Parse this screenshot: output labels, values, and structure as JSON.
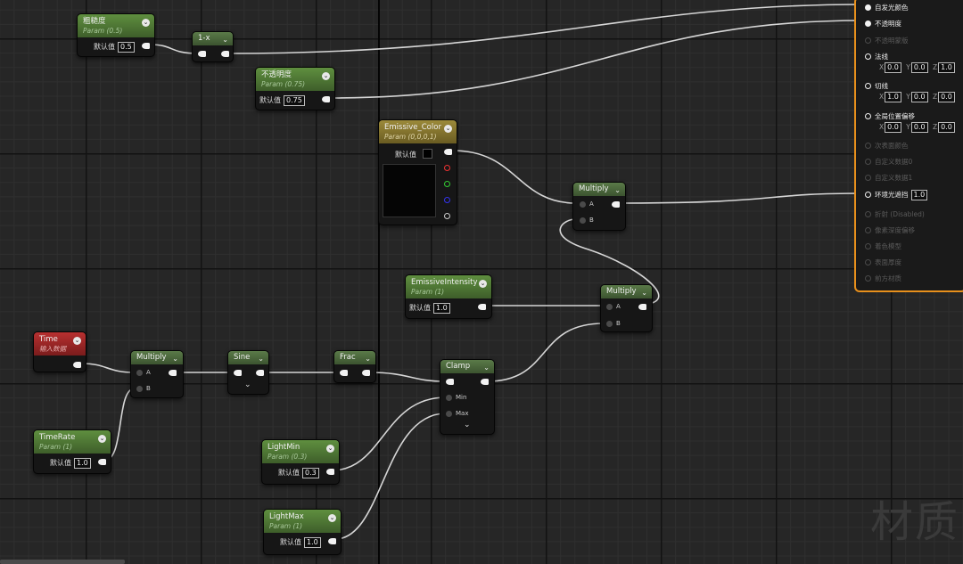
{
  "nodes": {
    "roughness": {
      "title": "粗糙度",
      "subtitle": "Param (0.5)",
      "label": "默认值",
      "value": "0.5"
    },
    "one_minus": {
      "title": "1-x"
    },
    "opacity": {
      "title": "不透明度",
      "subtitle": "Param (0.75)",
      "label": "默认值",
      "value": "0.75"
    },
    "emissive_color": {
      "title": "Emissive_Color",
      "subtitle": "Param (0,0,0,1)",
      "label": "默认值"
    },
    "multiply_top": {
      "title": "Multiply",
      "pin_a": "A",
      "pin_b": "B"
    },
    "emissive_intensity": {
      "title": "EmissiveIntensity",
      "subtitle": "Param (1)",
      "label": "默认值",
      "value": "1.0"
    },
    "multiply_mid": {
      "title": "Multiply",
      "pin_a": "A",
      "pin_b": "B"
    },
    "time": {
      "title": "Time",
      "subtitle": "输入数据"
    },
    "multiply_left": {
      "title": "Multiply",
      "pin_a": "A",
      "pin_b": "B"
    },
    "sine": {
      "title": "Sine"
    },
    "frac": {
      "title": "Frac"
    },
    "clamp": {
      "title": "Clamp",
      "pin_min": "Min",
      "pin_max": "Max"
    },
    "timerate": {
      "title": "TimeRate",
      "subtitle": "Param (1)",
      "label": "默认值",
      "value": "1.0"
    },
    "lightmin": {
      "title": "LightMin",
      "subtitle": "Param (0.3)",
      "label": "默认值",
      "value": "0.3"
    },
    "lightmax": {
      "title": "LightMax",
      "subtitle": "Param (1)",
      "label": "默认值",
      "value": "1.0"
    }
  },
  "result_panel": {
    "emissive": "自发光颜色",
    "opacity": "不透明度",
    "opacity_mask": "不透明蒙版",
    "normal": {
      "label": "法线",
      "x": "0.0",
      "y": "0.0",
      "z": "1.0"
    },
    "tangent": {
      "label": "切线",
      "x": "1.0",
      "y": "0.0",
      "z": "0.0"
    },
    "wpo": {
      "label": "全局位置偏移",
      "x": "0.0",
      "y": "0.0",
      "z": "0.0"
    },
    "subsurface": "次表面颜色",
    "custom0": "自定义数据0",
    "custom1": "自定义数据1",
    "ao": {
      "label": "环境光遮挡",
      "value": "1.0"
    },
    "refraction": "折射 (Disabled)",
    "pdo": "像素深度偏移",
    "shading_model": "着色模型",
    "surface_thickness": "表面厚度",
    "material_attributes": "前方材质",
    "axis_x": "X",
    "axis_y": "Y",
    "axis_z": "Z"
  },
  "watermark": "材质",
  "colors": {
    "accent": "#e8901c",
    "param_header": "#4f7a36",
    "time_header": "#9a2626",
    "emissive_header": "#857433"
  }
}
